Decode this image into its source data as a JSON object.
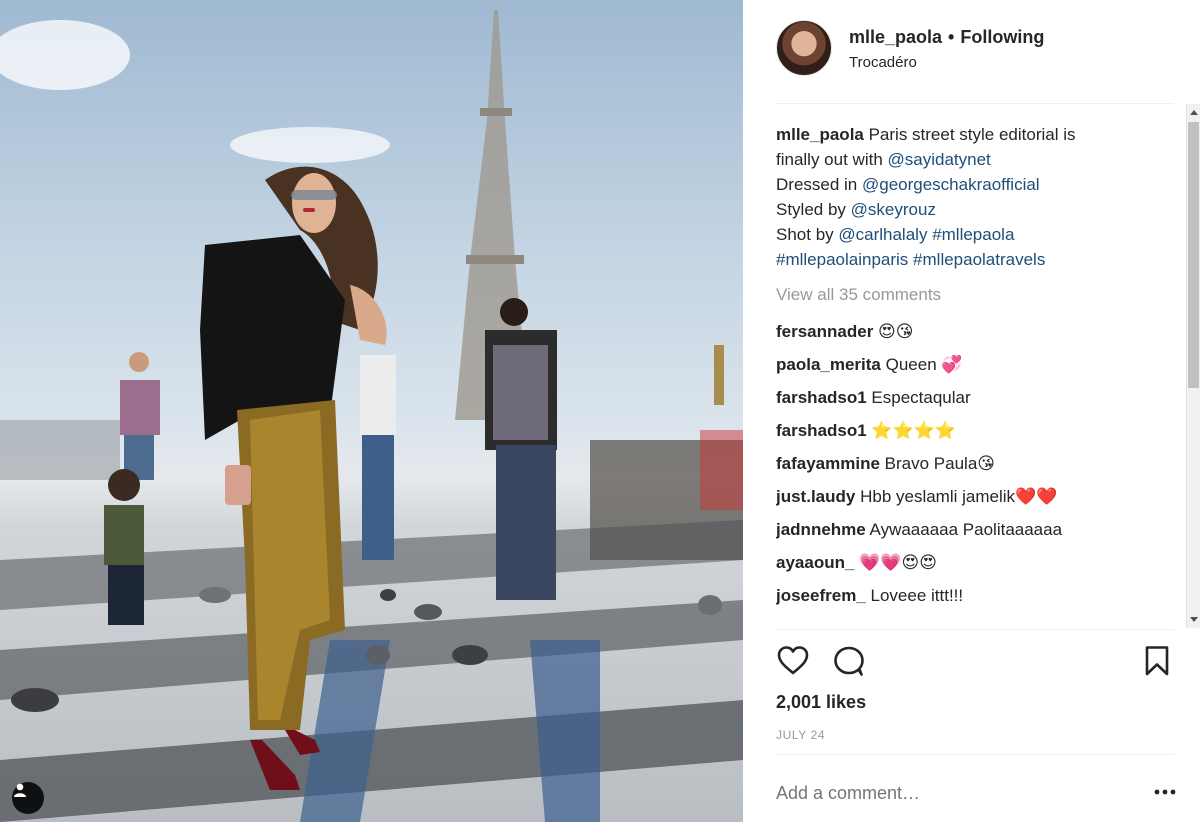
{
  "post": {
    "username": "mlle_paola",
    "separator": "•",
    "follow_status": "Following",
    "location": "Trocadéro"
  },
  "caption": {
    "username": "mlle_paola",
    "line1_text": " Paris street style editorial is",
    "line2_text": "finally out with ",
    "line2_link": "@sayidatynet",
    "line3_text": "Dressed in ",
    "line3_link": "@georgeschakraofficial",
    "line4_text": "Styled by ",
    "line4_link": "@skeyrouz",
    "line5_text": "Shot by ",
    "line5_link1": "@carlhalaly",
    "line5_link2": "#mllepaola",
    "line6_link1": "#mllepaolainparis",
    "line6_link2": "#mllepaolatravels"
  },
  "view_all_comments": "View all 35 comments",
  "comments": [
    {
      "user": "fersannader",
      "text": " 😍😘"
    },
    {
      "user": "paola_merita",
      "text": " Queen 💞"
    },
    {
      "user": "farshadso1",
      "text": " Espectaqular"
    },
    {
      "user": "farshadso1",
      "text": " ⭐⭐⭐⭐"
    },
    {
      "user": "fafayammine",
      "text": " Bravo Paula😘"
    },
    {
      "user": "just.laudy",
      "text": " Hbb yeslamli jamelik❤️❤️"
    },
    {
      "user": "jadnnehme",
      "text": " Aywaaaaaa Paolitaaaaaa"
    },
    {
      "user": "ayaaoun_",
      "text": " 💗💗😍😍"
    },
    {
      "user": "joseefrem_",
      "text": " Loveee ittt!!!"
    }
  ],
  "likes": "2,001 likes",
  "date": "JULY 24",
  "add_comment_placeholder": "Add a comment…",
  "icons": {
    "like": "heart-outline-icon",
    "comment": "speech-bubble-icon",
    "save": "bookmark-icon",
    "more": "ellipsis-icon",
    "tagged": "user-tag-icon"
  }
}
